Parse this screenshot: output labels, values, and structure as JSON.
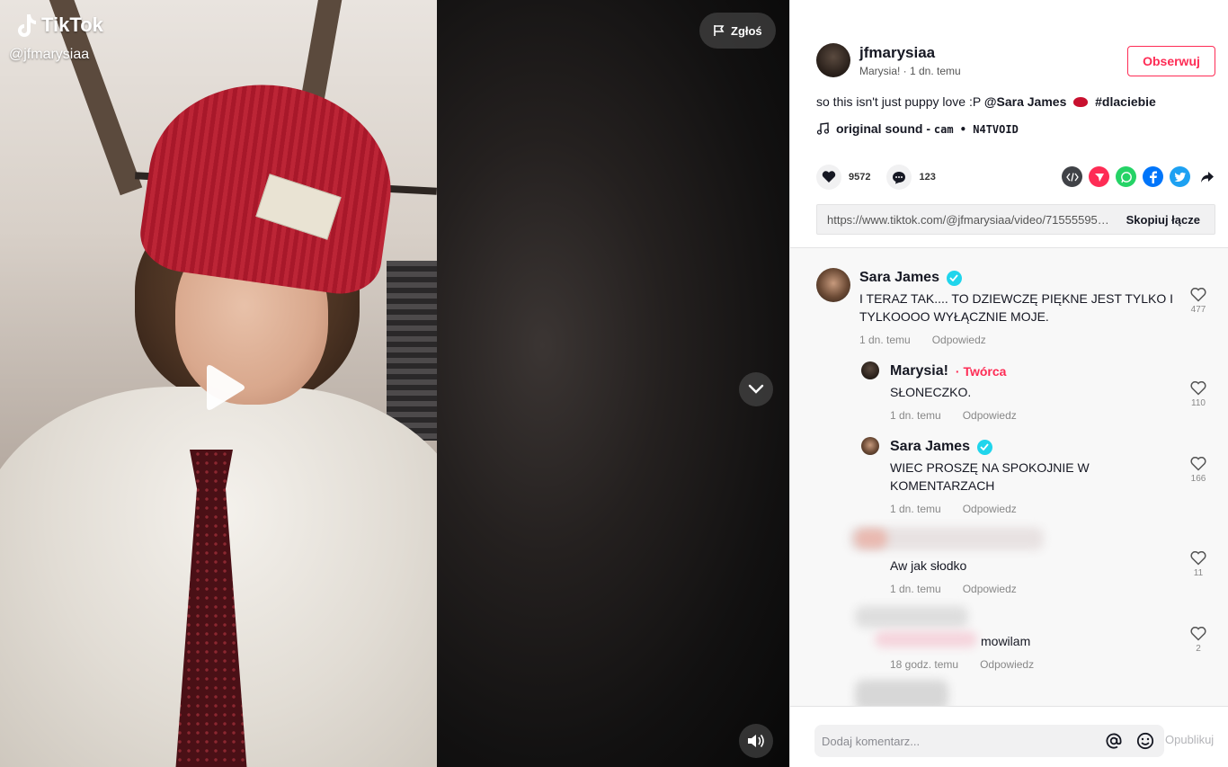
{
  "video": {
    "brand": "TikTok",
    "handle": "@jfmarysiaa",
    "report_label": "Zgłoś"
  },
  "post": {
    "username": "jfmarysiaa",
    "subtitle": "Marysia! · 1 dn. temu",
    "follow_label": "Obserwuj",
    "desc_text": "so this isn't just puppy love :P ",
    "desc_mention": "@Sara James",
    "desc_hashtag": "#dlaciebie",
    "music_title": "original sound - ",
    "music_artist": "cam • N4TVOID",
    "likes": "9572",
    "comments_count": "123",
    "link": "https://www.tiktok.com/@jfmarysiaa/video/7155559515...",
    "copy_label": "Skopiuj łącze"
  },
  "comments": [
    {
      "name": "Sara James",
      "text": "I TERAZ TAK.... TO DZIEWCZĘ PIĘKNE JEST TYLKO I TYLKOOOO WYŁĄCZNIE MOJE.",
      "time": "1 dn. temu",
      "reply": "Odpowiedz",
      "likes": "477"
    },
    {
      "name": "Marysia!",
      "badge": "· Twórca",
      "text": "SŁONECZKO.",
      "time": "1 dn. temu",
      "reply": "Odpowiedz",
      "likes": "110"
    },
    {
      "name": "Sara James",
      "text": "WIEC PROSZĘ NA SPOKOJNIE W KOMENTARZACH",
      "time": "1 dn. temu",
      "reply": "Odpowiedz",
      "likes": "166"
    },
    {
      "text": "Aw jak słodko",
      "time": "1 dn. temu",
      "reply": "Odpowiedz",
      "likes": "11"
    },
    {
      "text": "mowilam",
      "time": "18 godz. temu",
      "reply": "Odpowiedz",
      "likes": "2"
    }
  ],
  "composer": {
    "placeholder": "Dodaj komentarz...",
    "post_label": "Opublikuj"
  },
  "colors": {
    "accent": "#fe2c55",
    "verified": "#20d5ec"
  }
}
